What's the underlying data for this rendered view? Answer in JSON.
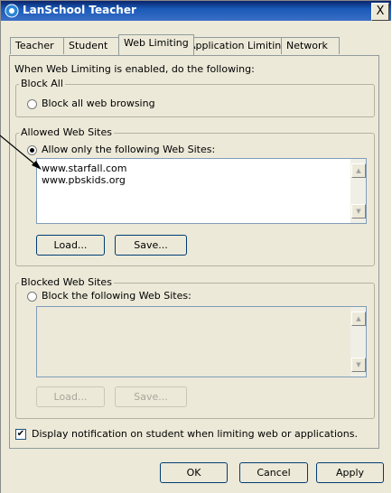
{
  "window": {
    "title": "LanSchool Teacher",
    "close_glyph": "X"
  },
  "tabs": [
    {
      "label": "Teacher"
    },
    {
      "label": "Student"
    },
    {
      "label": "Web Limiting"
    },
    {
      "label": "Application Limiting"
    },
    {
      "label": "Network"
    }
  ],
  "active_tab": "Web Limiting",
  "intro": "When Web Limiting is enabled, do the following:",
  "block_all": {
    "group_label": "Block All",
    "radio_label": "Block all web browsing",
    "checked": false
  },
  "allowed": {
    "group_label": "Allowed Web Sites",
    "radio_label": "Allow only the following Web Sites:",
    "checked": true,
    "sites": [
      "www.starfall.com",
      "www.pbskids.org"
    ],
    "load_label": "Load...",
    "save_label": "Save..."
  },
  "blocked": {
    "group_label": "Blocked Web Sites",
    "radio_label": "Block the following Web Sites:",
    "checked": false,
    "sites": [],
    "load_label": "Load...",
    "save_label": "Save..."
  },
  "notification": {
    "label": "Display notification on student when limiting web or applications.",
    "checked": true,
    "check_glyph": "✔"
  },
  "footer": {
    "ok_label": "OK",
    "cancel_label": "Cancel",
    "apply_label": "Apply"
  },
  "scroll_glyphs": {
    "up": "▲",
    "down": "▼"
  }
}
